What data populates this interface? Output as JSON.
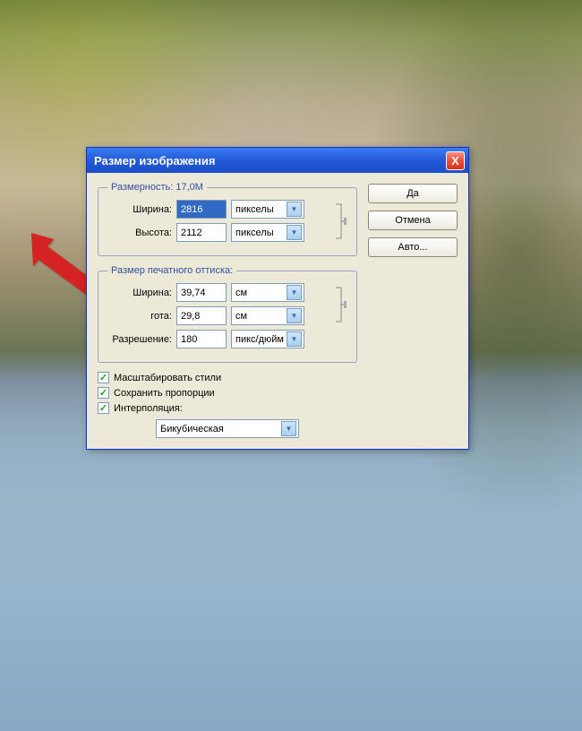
{
  "dialog": {
    "title": "Размер изображения",
    "close_label": "X"
  },
  "buttons": {
    "ok": "Да",
    "cancel": "Отмена",
    "auto": "Авто..."
  },
  "dimensions": {
    "legend": "Размерность:  17,0M",
    "width_label": "Ширина:",
    "width_value": "2816",
    "width_unit": "пикселы",
    "height_label": "Высота:",
    "height_value": "2112",
    "height_unit": "пикселы"
  },
  "print_size": {
    "legend": "Размер печатного оттиска:",
    "width_label": "Ширина:",
    "width_value": "39,74",
    "width_unit": "см",
    "height_label": "гота:",
    "height_value": "29,8",
    "height_unit": "см",
    "resolution_label": "Разрешение:",
    "resolution_value": "180",
    "resolution_unit": "пикс/дюйм"
  },
  "checkboxes": {
    "scale_styles": "Масштабировать стили",
    "constrain_proportions": "Сохранить пропорции",
    "interpolation": "Интерполяция:"
  },
  "interpolation_method": "Бикубическая"
}
